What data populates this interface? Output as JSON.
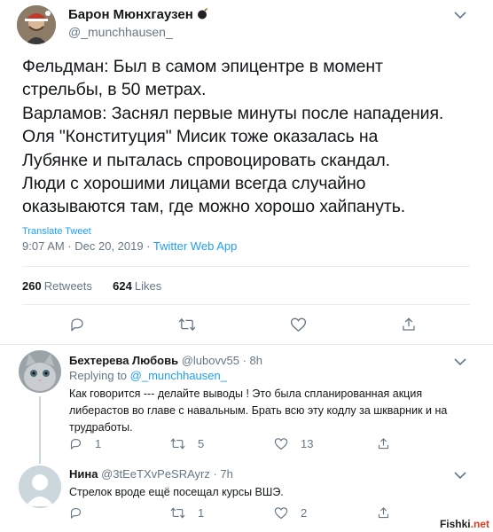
{
  "tweet": {
    "author_name": "Барон Мюнхгаузен",
    "author_handle": "@_munchhausen_",
    "text_lines": [
      "Фельдман: Был в самом эпицентре в момент",
      "стрельбы, в 50 метрах.",
      "Варламов: Заснял первые минуты после нападения.",
      "Оля \"Конституция\" Мисик тоже оказалась на",
      "Лубянке и пыталась спровоцировать скандал.",
      "Люди с хорошими лицами всегда случайно",
      "оказываются там, где можно хорошо хайпануть."
    ],
    "translate_label": "Translate Tweet",
    "timestamp": "9:07 AM · Dec 20, 2019 · ",
    "source": "Twitter Web App",
    "retweets_count": "260",
    "retweets_label": "Retweets",
    "likes_count": "624",
    "likes_label": "Likes"
  },
  "replies": [
    {
      "name": "Бехтерева Любовь",
      "handle": "@lubovv55",
      "time": " · 8h",
      "replying_prefix": "Replying to ",
      "replying_handle": "@_munchhausen_",
      "text_lines": [
        "Как говорится --- делайте выводы ! Это была спланированная акция",
        "либерастов во главе с навальным. Брать всю эту кодлу за шкварник и на",
        "трудработы."
      ],
      "reply_count": "1",
      "retweet_count": "5",
      "like_count": "13"
    },
    {
      "name": "Нина",
      "handle": "@3tEeTXvPeSRAyrz",
      "time": " · 7h",
      "text_lines": [
        "Стрелок вроде ещё посещал курсы ВШЭ."
      ],
      "reply_count": "",
      "retweet_count": "1",
      "like_count": "2"
    }
  ],
  "watermark": {
    "part1": "Fishki",
    "part2": ".net"
  },
  "colors": {
    "accent": "#1da1f2",
    "secondary_text": "#657786",
    "divider": "#e6ecf0"
  },
  "icons": [
    "bomb-icon",
    "chevron-down-icon",
    "reply-icon",
    "retweet-icon",
    "like-icon",
    "share-icon"
  ]
}
